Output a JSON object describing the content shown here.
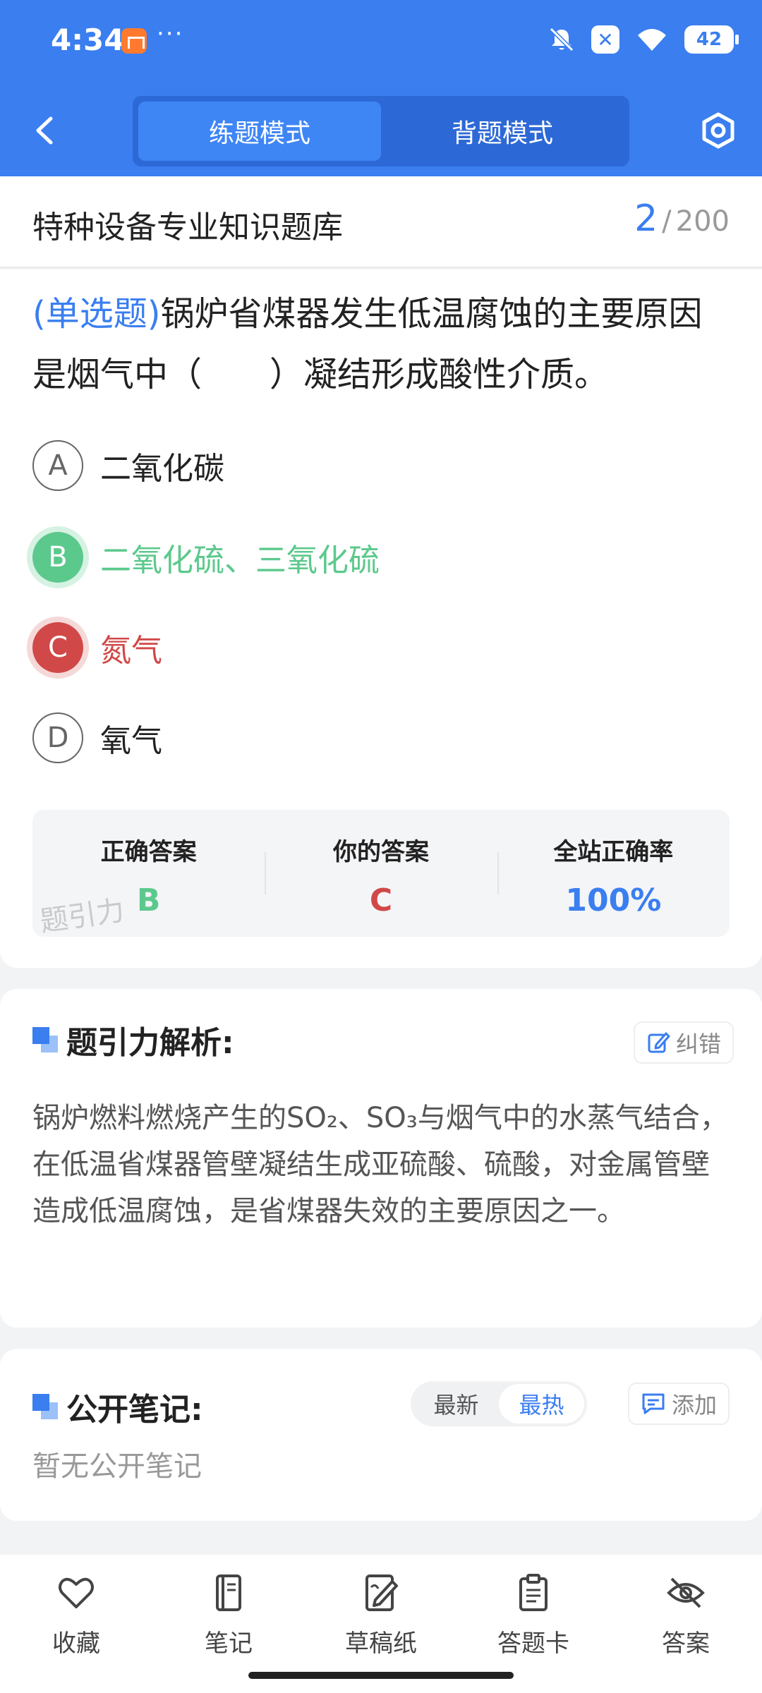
{
  "status_bar": {
    "time": "4:34",
    "dots": "···",
    "battery": "42"
  },
  "header": {
    "tabs": [
      {
        "label": "练题模式",
        "active": true
      },
      {
        "label": "背题模式",
        "active": false
      }
    ],
    "back_icon": "chevron-left-icon",
    "settings_icon": "hexagon-settings-icon"
  },
  "title_bar": {
    "title": "特种设备专业知识题库",
    "current": "2",
    "separator": "/",
    "total": "200"
  },
  "question": {
    "type": "(单选题)",
    "text": "锅炉省煤器发生低温腐蚀的主要原因是烟气中（　　）凝结形成酸性介质。",
    "options": [
      {
        "letter": "A",
        "text": "二氧化碳",
        "state": "normal"
      },
      {
        "letter": "B",
        "text": "二氧化硫、三氧化硫",
        "state": "correct"
      },
      {
        "letter": "C",
        "text": "氮气",
        "state": "wrong"
      },
      {
        "letter": "D",
        "text": "氧气",
        "state": "normal"
      }
    ]
  },
  "answer_summary": {
    "correct_label": "正确答案",
    "correct_value": "B",
    "yours_label": "你的答案",
    "yours_value": "C",
    "rate_label": "全站正确率",
    "rate_value": "100%",
    "watermark": "题引力"
  },
  "analysis": {
    "title": "题引力解析:",
    "correct_btn": "纠错",
    "text": "锅炉燃料燃烧产生的SO₂、SO₃与烟气中的水蒸气结合，在低温省煤器管壁凝结生成亚硫酸、硫酸，对金属管壁造成低温腐蚀，是省煤器失效的主要原因之一。"
  },
  "notes": {
    "title": "公开笔记:",
    "sort_options": [
      {
        "label": "最新",
        "active": false
      },
      {
        "label": "最热",
        "active": true
      }
    ],
    "add_btn": "添加",
    "empty_text": "暂无公开笔记"
  },
  "bottom_nav": [
    {
      "label": "收藏",
      "icon": "heart-icon"
    },
    {
      "label": "笔记",
      "icon": "notebook-icon"
    },
    {
      "label": "草稿纸",
      "icon": "draft-paper-icon"
    },
    {
      "label": "答题卡",
      "icon": "clipboard-icon"
    },
    {
      "label": "答案",
      "icon": "eye-off-icon"
    }
  ],
  "colors": {
    "brand": "#3a7ef0",
    "correct": "#5cc98c",
    "wrong": "#d14848"
  }
}
